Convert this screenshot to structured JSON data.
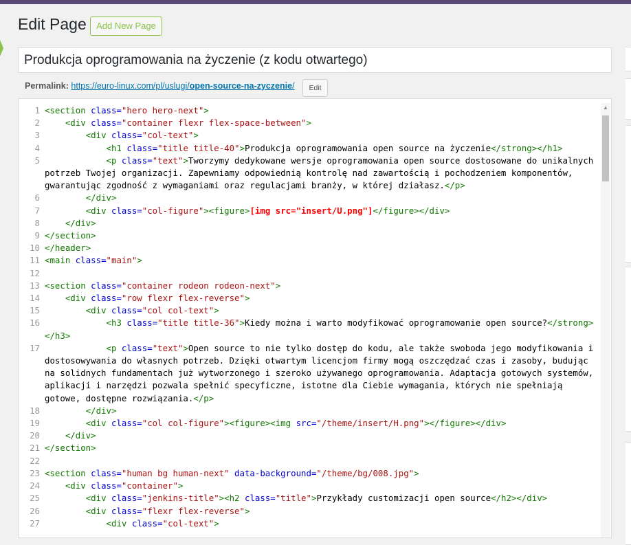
{
  "header": {
    "title": "Edit Page",
    "add_new_label": "Add New Page"
  },
  "post": {
    "title": "Produkcja oprogramowania na życzenie (z kodu otwartego)"
  },
  "permalink": {
    "label": "Permalink:",
    "base": "https://euro-linux.com/pl/uslugi/",
    "slug": "open-source-na-zyczenie",
    "trailing": "/",
    "edit_label": "Edit"
  },
  "colors": {
    "accent_green": "#8bc34a",
    "link_blue": "#0073aa",
    "admin_bar": "#5b4a78"
  },
  "editor": {
    "lines": [
      {
        "n": "1",
        "html": "<span class=\"t\">&lt;section</span> <span class=\"a\">class=</span><span class=\"s\">\"hero hero-next\"</span><span class=\"t\">&gt;</span>"
      },
      {
        "n": "2",
        "html": "    <span class=\"t\">&lt;div</span> <span class=\"a\">class=</span><span class=\"s\">\"container flexr flex-space-between\"</span><span class=\"t\">&gt;</span>"
      },
      {
        "n": "3",
        "html": "        <span class=\"t\">&lt;div</span> <span class=\"a\">class=</span><span class=\"s\">\"col-text\"</span><span class=\"t\">&gt;</span>"
      },
      {
        "n": "4",
        "html": "            <span class=\"t\">&lt;h1</span> <span class=\"a\">class=</span><span class=\"s\">\"title title-40\"</span><span class=\"t\">&gt;</span>Produkcja oprogramowania open source na życzenie<span class=\"t\">&lt;/strong&gt;&lt;/h1&gt;</span>"
      },
      {
        "n": "5",
        "html": "            <span class=\"t\">&lt;p</span> <span class=\"a\">class=</span><span class=\"s\">\"text\"</span><span class=\"t\">&gt;</span>Tworzymy dedykowane wersje oprogramowania open source dostosowane do unikalnych potrzeb Twojej organizacji. Zapewniamy odpowiednią kontrolę nad zawartością i pochodzeniem komponentów, gwarantując zgodność z wymaganiami oraz regulacjami branży, w której działasz.<span class=\"t\">&lt;/p&gt;</span>"
      },
      {
        "n": "6",
        "html": "        <span class=\"t\">&lt;/div&gt;</span>"
      },
      {
        "n": "7",
        "html": "        <span class=\"t\">&lt;div</span> <span class=\"a\">class=</span><span class=\"s\">\"col-figure\"</span><span class=\"t\">&gt;&lt;figure&gt;</span><span class=\"sc\">[img src=\"insert/U.png\"]</span><span class=\"t\">&lt;/figure&gt;&lt;/div&gt;</span>"
      },
      {
        "n": "8",
        "html": "    <span class=\"t\">&lt;/div&gt;</span>"
      },
      {
        "n": "9",
        "html": "<span class=\"t\">&lt;/section&gt;</span>"
      },
      {
        "n": "10",
        "html": "<span class=\"t\">&lt;/header&gt;</span>"
      },
      {
        "n": "11",
        "html": "<span class=\"t\">&lt;main</span> <span class=\"a\">class=</span><span class=\"s\">\"main\"</span><span class=\"t\">&gt;</span>"
      },
      {
        "n": "12",
        "html": " "
      },
      {
        "n": "13",
        "html": "<span class=\"t\">&lt;section</span> <span class=\"a\">class=</span><span class=\"s\">\"container rodeon rodeon-next\"</span><span class=\"t\">&gt;</span>"
      },
      {
        "n": "14",
        "html": "    <span class=\"t\">&lt;div</span> <span class=\"a\">class=</span><span class=\"s\">\"row flexr flex-reverse\"</span><span class=\"t\">&gt;</span>"
      },
      {
        "n": "15",
        "html": "        <span class=\"t\">&lt;div</span> <span class=\"a\">class=</span><span class=\"s\">\"col col-text\"</span><span class=\"t\">&gt;</span>"
      },
      {
        "n": "16",
        "html": "            <span class=\"t\">&lt;h3</span> <span class=\"a\">class=</span><span class=\"s\">\"title title-36\"</span><span class=\"t\">&gt;</span>Kiedy można i warto modyfikować oprogramowanie open source?<span class=\"t\">&lt;/strong&gt;</span>\n<span class=\"t\">&lt;/h3&gt;</span>"
      },
      {
        "n": "17",
        "html": "            <span class=\"t\">&lt;p</span> <span class=\"a\">class=</span><span class=\"s\">\"text\"</span><span class=\"t\">&gt;</span>Open source to nie tylko dostęp do kodu, ale także swoboda jego modyfikowania i dostosowywania do własnych potrzeb. Dzięki otwartym licencjom firmy mogą oszczędzać czas i zasoby, budując na solidnych fundamentach już wytworzonego i szeroko używanego oprogramowania. Adaptacja gotowych systemów, aplikacji i narzędzi pozwala spełnić specyficzne, istotne dla Ciebie wymagania, których nie spełniają gotowe, dostępne rozwiązania.<span class=\"t\">&lt;/p&gt;</span>"
      },
      {
        "n": "18",
        "html": "        <span class=\"t\">&lt;/div&gt;</span>"
      },
      {
        "n": "19",
        "html": "        <span class=\"t\">&lt;div</span> <span class=\"a\">class=</span><span class=\"s\">\"col col-figure\"</span><span class=\"t\">&gt;&lt;figure&gt;&lt;img</span> <span class=\"a\">src=</span><span class=\"s\">\"/theme/insert/H.png\"</span><span class=\"t\">&gt;&lt;/figure&gt;&lt;/div&gt;</span>"
      },
      {
        "n": "20",
        "html": "    <span class=\"t\">&lt;/div&gt;</span>"
      },
      {
        "n": "21",
        "html": "<span class=\"t\">&lt;/section&gt;</span>"
      },
      {
        "n": "22",
        "html": " "
      },
      {
        "n": "23",
        "html": "<span class=\"t\">&lt;section</span> <span class=\"a\">class=</span><span class=\"s\">\"human bg human-next\"</span> <span class=\"a\">data-background=</span><span class=\"s\">\"/theme/bg/008.jpg\"</span><span class=\"t\">&gt;</span>"
      },
      {
        "n": "24",
        "html": "    <span class=\"t\">&lt;div</span> <span class=\"a\">class=</span><span class=\"s\">\"container\"</span><span class=\"t\">&gt;</span>"
      },
      {
        "n": "25",
        "html": "        <span class=\"t\">&lt;div</span> <span class=\"a\">class=</span><span class=\"s\">\"jenkins-title\"</span><span class=\"t\">&gt;&lt;h2</span> <span class=\"a\">class=</span><span class=\"s\">\"title\"</span><span class=\"t\">&gt;</span>Przykłady customizacji open source<span class=\"t\">&lt;/h2&gt;&lt;/div&gt;</span>"
      },
      {
        "n": "26",
        "html": "        <span class=\"t\">&lt;div</span> <span class=\"a\">class=</span><span class=\"s\">\"flexr flex-reverse\"</span><span class=\"t\">&gt;</span>"
      },
      {
        "n": "27",
        "html": "            <span class=\"t\">&lt;div</span> <span class=\"a\">class=</span><span class=\"s\">\"col-text\"</span><span class=\"t\">&gt;</span>"
      }
    ]
  }
}
